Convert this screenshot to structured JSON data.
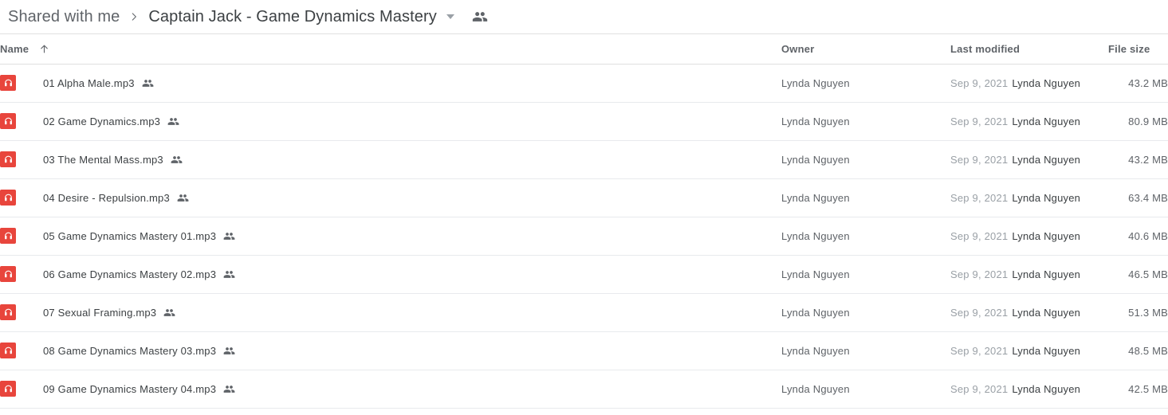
{
  "breadcrumb": {
    "root_label": "Shared with me",
    "separator": "chevron-right",
    "current_label": "Captain Jack - Game Dynamics Mastery",
    "dropdown_icon": "chevron-down-icon",
    "people_icon": "people-icon"
  },
  "table": {
    "columns": {
      "name": "Name",
      "owner": "Owner",
      "last_modified": "Last modified",
      "file_size": "File size"
    },
    "sort": {
      "column": "Name",
      "direction": "ascending",
      "icon": "arrow-up-icon"
    },
    "rows": [
      {
        "icon": "audio-file-icon",
        "name": "01 Alpha Male.mp3",
        "shared_icon": "people-icon",
        "owner": "Lynda Nguyen",
        "modified_date": "Sep 9, 2021",
        "modified_by": "Lynda Nguyen",
        "size": "43.2 MB"
      },
      {
        "icon": "audio-file-icon",
        "name": "02 Game Dynamics.mp3",
        "shared_icon": "people-icon",
        "owner": "Lynda Nguyen",
        "modified_date": "Sep 9, 2021",
        "modified_by": "Lynda Nguyen",
        "size": "80.9 MB"
      },
      {
        "icon": "audio-file-icon",
        "name": "03 The Mental Mass.mp3",
        "shared_icon": "people-icon",
        "owner": "Lynda Nguyen",
        "modified_date": "Sep 9, 2021",
        "modified_by": "Lynda Nguyen",
        "size": "43.2 MB"
      },
      {
        "icon": "audio-file-icon",
        "name": "04 Desire - Repulsion.mp3",
        "shared_icon": "people-icon",
        "owner": "Lynda Nguyen",
        "modified_date": "Sep 9, 2021",
        "modified_by": "Lynda Nguyen",
        "size": "63.4 MB"
      },
      {
        "icon": "audio-file-icon",
        "name": "05 Game Dynamics Mastery 01.mp3",
        "shared_icon": "people-icon",
        "owner": "Lynda Nguyen",
        "modified_date": "Sep 9, 2021",
        "modified_by": "Lynda Nguyen",
        "size": "40.6 MB"
      },
      {
        "icon": "audio-file-icon",
        "name": "06 Game Dynamics Mastery 02.mp3",
        "shared_icon": "people-icon",
        "owner": "Lynda Nguyen",
        "modified_date": "Sep 9, 2021",
        "modified_by": "Lynda Nguyen",
        "size": "46.5 MB"
      },
      {
        "icon": "audio-file-icon",
        "name": "07 Sexual Framing.mp3",
        "shared_icon": "people-icon",
        "owner": "Lynda Nguyen",
        "modified_date": "Sep 9, 2021",
        "modified_by": "Lynda Nguyen",
        "size": "51.3 MB"
      },
      {
        "icon": "audio-file-icon",
        "name": "08 Game Dynamics Mastery 03.mp3",
        "shared_icon": "people-icon",
        "owner": "Lynda Nguyen",
        "modified_date": "Sep 9, 2021",
        "modified_by": "Lynda Nguyen",
        "size": "48.5 MB"
      },
      {
        "icon": "audio-file-icon",
        "name": "09 Game Dynamics Mastery 04.mp3",
        "shared_icon": "people-icon",
        "owner": "Lynda Nguyen",
        "modified_date": "Sep 9, 2021",
        "modified_by": "Lynda Nguyen",
        "size": "42.5 MB"
      }
    ]
  },
  "colors": {
    "audio_icon_red": "#e8453c",
    "primary_text": "#3c4043",
    "secondary_text": "#5f6368",
    "muted_text": "#9aa0a6",
    "divider": "#e8eaed"
  }
}
